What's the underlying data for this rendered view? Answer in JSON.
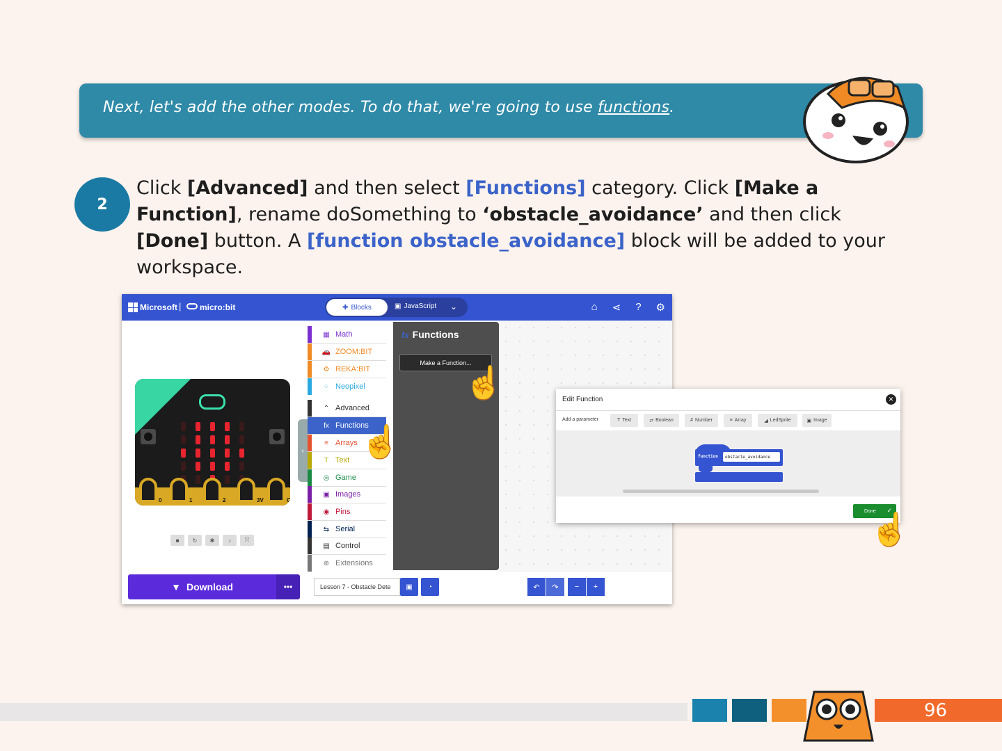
{
  "banner": {
    "text_before": "Next, let's add the other modes. To do that, we're going to use ",
    "link_word": "functions",
    "text_after": "."
  },
  "step": {
    "number": "2",
    "parts": [
      {
        "t": "Click ",
        "s": "plain"
      },
      {
        "t": "[Advanced]",
        "s": "bold"
      },
      {
        "t": " and then select ",
        "s": "plain"
      },
      {
        "t": "[Functions]",
        "s": "blue"
      },
      {
        "t": " category. Click ",
        "s": "plain"
      },
      {
        "t": "[Make a Function]",
        "s": "bold"
      },
      {
        "t": ", rename doSomething to ",
        "s": "plain"
      },
      {
        "t": "‘obstacle_avoidance’",
        "s": "bold"
      },
      {
        "t": " and then click ",
        "s": "plain"
      },
      {
        "t": "[Done]",
        "s": "bold"
      },
      {
        "t": " button.  A ",
        "s": "plain"
      },
      {
        "t": "[function obstacle_avoidance]",
        "s": "blue"
      },
      {
        "t": " block will be added to your workspace.",
        "s": "plain"
      }
    ]
  },
  "editor": {
    "brand": "Microsoft",
    "product": "micro:bit",
    "mode_blocks": "Blocks",
    "mode_js": "JavaScript",
    "top_icons": [
      "home-icon",
      "share-icon",
      "help-icon",
      "settings-icon"
    ],
    "toolbox": [
      {
        "label": "Math",
        "icon": "▦",
        "color": "#7b2fd1",
        "text": "#7b2fd1",
        "selected": false
      },
      {
        "label": "ZOOM:BIT",
        "icon": "🚗",
        "color": "#f08a24",
        "text": "#f08a24",
        "selected": false
      },
      {
        "label": "REKA:BIT",
        "icon": "⚙",
        "color": "#f08a24",
        "text": "#f08a24",
        "selected": false
      },
      {
        "label": "Neopixel",
        "icon": "⁘",
        "color": "#2aa9e0",
        "text": "#2aa9e0",
        "selected": false
      },
      {
        "label": "Advanced",
        "icon": "⌃",
        "color": "#333333",
        "text": "#333333",
        "selected": false
      },
      {
        "label": "Functions",
        "icon": "fx",
        "color": "#3b63c9",
        "text": "#ffffff",
        "selected": true
      },
      {
        "label": "Arrays",
        "icon": "≡",
        "color": "#e4532f",
        "text": "#e4532f",
        "selected": false
      },
      {
        "label": "Text",
        "icon": "T",
        "color": "#b8a800",
        "text": "#b8a800",
        "selected": false
      },
      {
        "label": "Game",
        "icon": "◎",
        "color": "#1c8a46",
        "text": "#1c8a46",
        "selected": false
      },
      {
        "label": "Images",
        "icon": "▣",
        "color": "#7a1fa6",
        "text": "#7a1fa6",
        "selected": false
      },
      {
        "label": "Pins",
        "icon": "◉",
        "color": "#c0193a",
        "text": "#c0193a",
        "selected": false
      },
      {
        "label": "Serial",
        "icon": "⇆",
        "color": "#002050",
        "text": "#002050",
        "selected": false
      },
      {
        "label": "Control",
        "icon": "▤",
        "color": "#333333",
        "text": "#333333",
        "selected": false
      },
      {
        "label": "Extensions",
        "icon": "⊕",
        "color": "#777777",
        "text": "#777777",
        "selected": false
      }
    ],
    "flyout_title": "Functions",
    "make_function": "Make a Function...",
    "download": "Download",
    "project_name": "Lesson 7 - Obstacle Dete",
    "pins": [
      "0",
      "1",
      "2",
      "3V",
      "GND"
    ]
  },
  "dialog": {
    "title": "Edit Function",
    "add_param_label": "Add a parameter",
    "param_buttons": [
      "Text",
      "Boolean",
      "Number",
      "Array",
      "LedSprite",
      "Image"
    ],
    "keyword": "function",
    "name": "obstacle_avoidance",
    "done": "Done"
  },
  "footer": {
    "page": "96",
    "colors": [
      "#1a82ad",
      "#0f5f7f",
      "#f4902b",
      "#f26a2b"
    ]
  }
}
